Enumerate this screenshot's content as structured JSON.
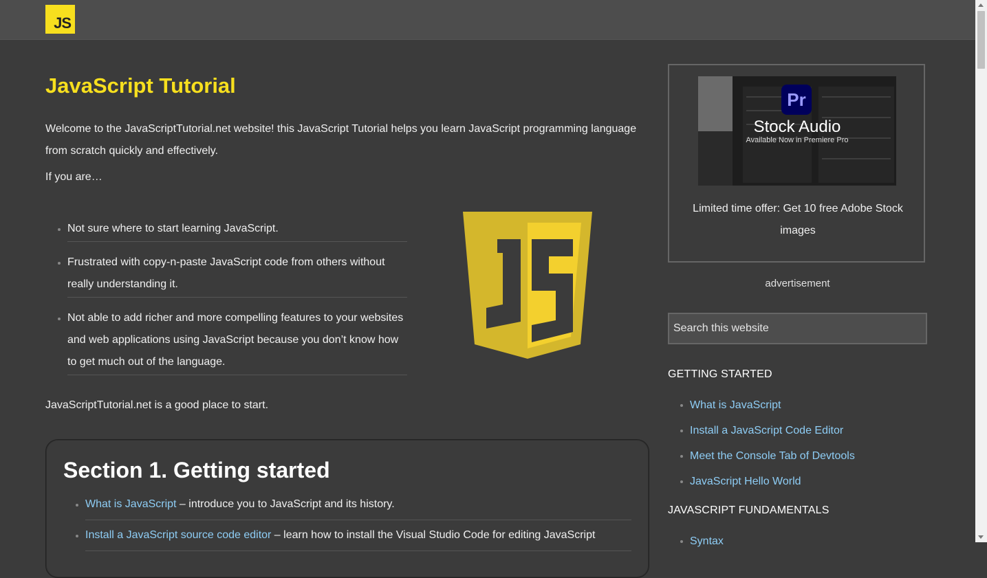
{
  "header": {
    "logo_text": "JS"
  },
  "main": {
    "title": "JavaScript Tutorial",
    "intro": "Welcome to the JavaScriptTutorial.net website! this JavaScript Tutorial helps you learn JavaScript programming language from scratch quickly and effectively.",
    "if_you_are": "If you are…",
    "bullets": [
      "Not sure where to start learning JavaScript.",
      "Frustrated with copy-n-paste JavaScript code from others without really understanding it.",
      "Not able to add richer and more compelling features to your websites and web applications using JavaScript because you don’t know how to get much out of the language."
    ],
    "good_place": "JavaScriptTutorial.net is a good place to start.",
    "section": {
      "title": "Section 1. Getting started",
      "items": [
        {
          "link": "What is JavaScript",
          "desc": " – introduce you to JavaScript and its history."
        },
        {
          "link": "Install a JavaScript source code editor",
          "desc": " – learn how to install the Visual Studio Code for editing JavaScript"
        }
      ]
    }
  },
  "sidebar": {
    "ad": {
      "image_brand": "Pr",
      "image_title": "Stock Audio",
      "image_subtitle": "Available Now in Premiere Pro",
      "text": "Limited time offer: Get 10 free Adobe Stock images"
    },
    "ad_label": "advertisement",
    "search_placeholder": "Search this website",
    "getting_started": {
      "title": "GETTING STARTED",
      "items": [
        "What is JavaScript",
        "Install a JavaScript Code Editor",
        "Meet the Console Tab of Devtools",
        "JavaScript Hello World"
      ]
    },
    "fundamentals": {
      "title": "JAVASCRIPT FUNDAMENTALS",
      "items": [
        "Syntax"
      ]
    }
  },
  "colors": {
    "background": "#3b3b3b",
    "header": "#4d4d4d",
    "accent_yellow": "#f7df1e",
    "link": "#8ecdf5"
  }
}
